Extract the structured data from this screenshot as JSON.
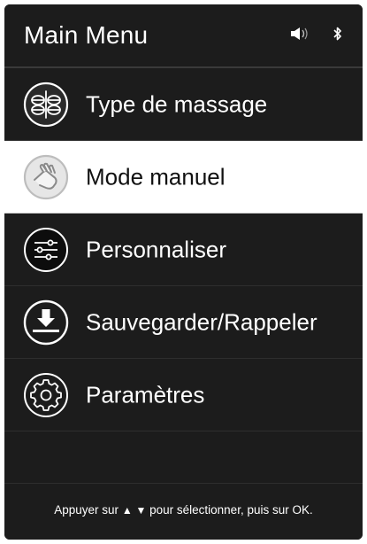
{
  "header": {
    "title": "Main Menu",
    "icons": [
      "speaker-icon",
      "bluetooth-icon"
    ]
  },
  "menu": {
    "items": [
      {
        "label": "Type de massage",
        "icon": "massage-rollers-icon",
        "selected": false
      },
      {
        "label": "Mode manuel",
        "icon": "hand-icon",
        "selected": true
      },
      {
        "label": "Personnaliser",
        "icon": "sliders-icon",
        "selected": false
      },
      {
        "label": "Sauvegarder/Rappeler",
        "icon": "download-icon",
        "selected": false
      },
      {
        "label": "Paramètres",
        "icon": "gear-icon",
        "selected": false
      }
    ]
  },
  "footer": {
    "prefix": "Appuyer sur",
    "up_arrow": "▲",
    "down_arrow": "▼",
    "suffix": "pour sélectionner, puis sur OK."
  },
  "colors": {
    "screen_bg": "#1c1c1c",
    "selected_bg": "#ffffff",
    "text": "#ffffff",
    "selected_text": "#111111"
  }
}
